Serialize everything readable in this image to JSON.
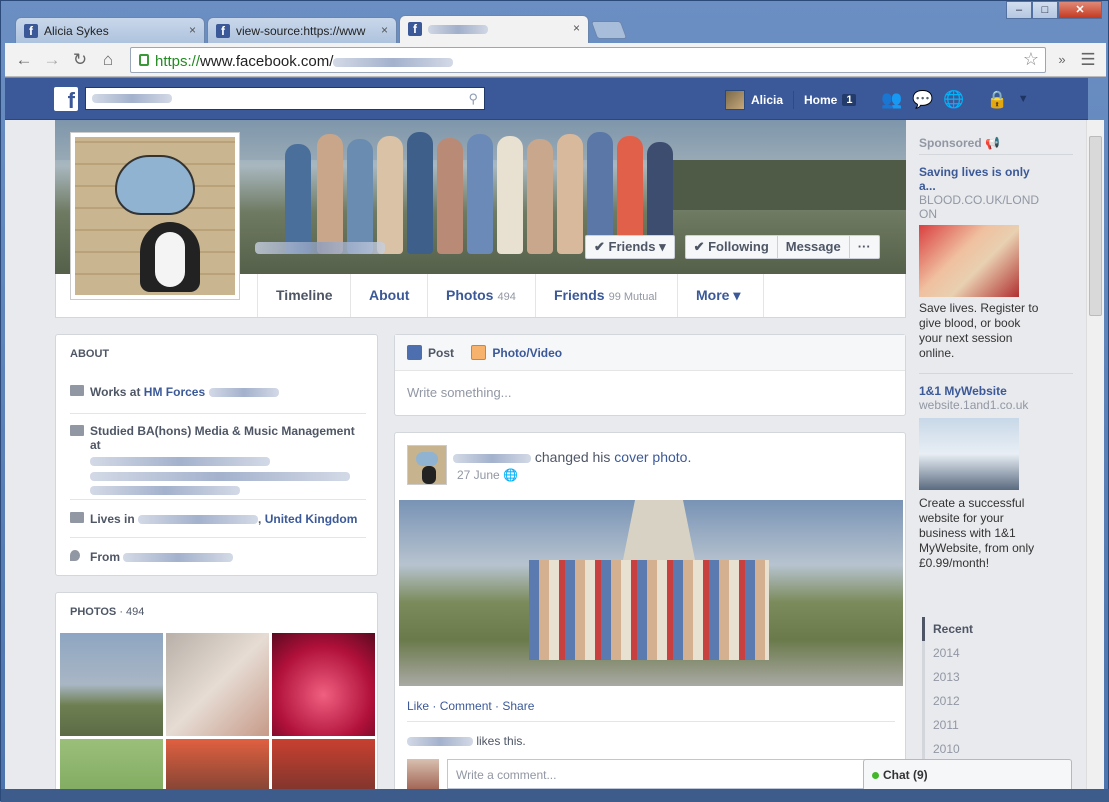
{
  "browser": {
    "tabs": [
      {
        "title": "Alicia Sykes",
        "close": "×"
      },
      {
        "title": "view-source:https://www",
        "close": "×"
      },
      {
        "title": "",
        "close": "×"
      }
    ],
    "url_scheme": "https://",
    "url_host": "www.facebook.com/",
    "window_buttons": [
      "–",
      "□",
      "✕"
    ]
  },
  "fb_header": {
    "logo": "f",
    "user_name": "Alicia",
    "home_label": "Home",
    "home_badge": "1"
  },
  "profile": {
    "buttons": {
      "friends": "✔ Friends ▾",
      "following": "✔ Following",
      "message": "Message",
      "more": "···"
    },
    "nav": [
      {
        "label": "Timeline",
        "count": ""
      },
      {
        "label": "About",
        "count": ""
      },
      {
        "label": "Photos",
        "count": "494"
      },
      {
        "label": "Friends",
        "count": "99 Mutual"
      },
      {
        "label": "More ▾",
        "count": ""
      }
    ]
  },
  "about": {
    "heading": "ABOUT",
    "works_prefix": "Works at ",
    "works_link": "HM Forces",
    "studied": "Studied BA(hons) Media & Music Management at",
    "lives_prefix": "Lives in ",
    "lives_link": "United Kingdom",
    "from_prefix": "From "
  },
  "photos": {
    "heading": "PHOTOS",
    "count": "· 494"
  },
  "composer": {
    "post_tab": "Post",
    "photo_tab": "Photo/Video",
    "placeholder": "Write something..."
  },
  "story": {
    "action": "changed his",
    "link": "cover photo.",
    "date": "27 June",
    "like": "Like",
    "comment": "Comment",
    "share": "Share",
    "likes_this": "likes this.",
    "comment_placeholder": "Write a comment..."
  },
  "sidebar": {
    "sponsored": "Sponsored",
    "ad1": {
      "title": "Saving lives is only a...",
      "domain": "BLOOD.CO.UK/LONDON",
      "text": "Save lives. Register to give blood, or book your next session online."
    },
    "ad2": {
      "title": "1&1 MyWebsite",
      "domain": "website.1and1.co.uk",
      "text": "Create a successful website for your business with 1&1 MyWebsite, from only £0.99/month!"
    },
    "timeline_years": [
      "Recent",
      "2014",
      "2013",
      "2012",
      "2011",
      "2010"
    ]
  },
  "chat": {
    "label": "Chat (9)"
  }
}
